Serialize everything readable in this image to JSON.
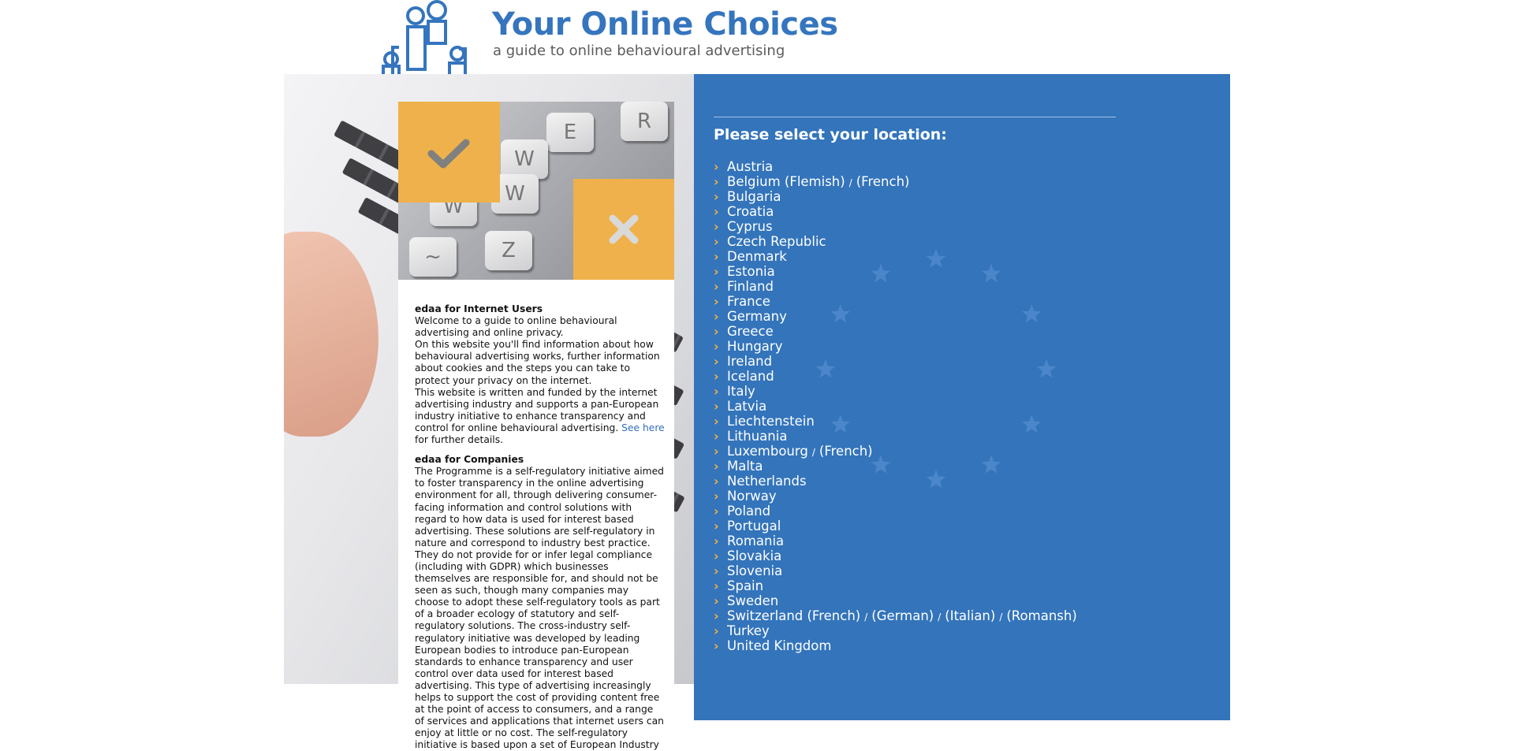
{
  "header": {
    "title": "Your Online Choices",
    "tagline": "a guide to online behavioural advertising"
  },
  "intro": {
    "users_heading": "edaa for Internet Users",
    "users_p1": "Welcome to a guide to online behavioural advertising and online privacy.",
    "users_p2": "On this website you'll find information about how behavioural advertising works, further information about cookies and the steps you can take to protect your privacy on the internet.",
    "users_p3": "This website is written and funded by the internet advertising industry and supports a pan-European industry initiative to enhance transparency and control for online behavioural advertising.",
    "see_here_link": "See here",
    "users_p3_tail": "for further details.",
    "companies_heading": "edaa for Companies",
    "companies_text": "The Programme is a self-regulatory initiative aimed to foster transparency in the online advertising environment for all, through delivering consumer-facing information and control solutions with regard to how data is used for interest based advertising. These solutions are self-regulatory in nature and correspond to industry best practice. They do not provide for or infer legal compliance (including with GDPR) which businesses themselves are responsible for, and should not be seen as such, though many companies may choose to adopt these self-regulatory tools as part of a broader ecology of statutory and self-regulatory solutions. The cross-industry self-regulatory initiative was developed by leading European bodies to introduce pan-European standards to enhance transparency and user control over data used for interest based advertising. This type of advertising increasingly helps to support the cost of providing content free at the point of access to consumers, and a range of services and applications that internet users can enjoy at little or no cost. The self-regulatory initiative is based upon a set of European Industry"
  },
  "image": {
    "keys": [
      "R",
      "E",
      "W",
      "W",
      "W",
      "Z",
      "~"
    ]
  },
  "location": {
    "heading": "Please select your location:",
    "separator": "/",
    "countries": [
      [
        "Austria"
      ],
      [
        "Belgium (Flemish)",
        "(French)"
      ],
      [
        "Bulgaria"
      ],
      [
        "Croatia"
      ],
      [
        "Cyprus"
      ],
      [
        "Czech Republic"
      ],
      [
        "Denmark"
      ],
      [
        "Estonia"
      ],
      [
        "Finland"
      ],
      [
        "France"
      ],
      [
        "Germany"
      ],
      [
        "Greece"
      ],
      [
        "Hungary"
      ],
      [
        "Ireland"
      ],
      [
        "Iceland"
      ],
      [
        "Italy"
      ],
      [
        "Latvia"
      ],
      [
        "Liechtenstein"
      ],
      [
        "Lithuania"
      ],
      [
        "Luxembourg",
        "(French)"
      ],
      [
        "Malta"
      ],
      [
        "Netherlands"
      ],
      [
        "Norway"
      ],
      [
        "Poland"
      ],
      [
        "Portugal"
      ],
      [
        "Romania"
      ],
      [
        "Slovakia"
      ],
      [
        "Slovenia"
      ],
      [
        "Spain"
      ],
      [
        "Sweden"
      ],
      [
        "Switzerland (French)",
        "(German)",
        "(Italian)",
        "(Romansh)"
      ],
      [
        "Turkey"
      ],
      [
        "United Kingdom"
      ]
    ]
  },
  "colors": {
    "brand_blue": "#3374bb",
    "accent_orange": "#efb14b",
    "link_blue": "#2f6fbd"
  }
}
